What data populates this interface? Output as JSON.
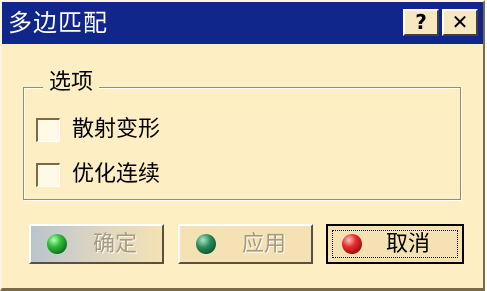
{
  "window": {
    "title": "多边匹配",
    "help_label": "?",
    "close_label": "✕"
  },
  "options_group": {
    "label": "选项",
    "items": [
      {
        "label": "散射变形",
        "checked": false
      },
      {
        "label": "优化连续",
        "checked": false
      }
    ]
  },
  "buttons": {
    "ok": {
      "label": "确定",
      "icon": "green-ball-icon",
      "enabled": false
    },
    "apply": {
      "label": "应用",
      "icon": "green-ball-icon",
      "enabled": false
    },
    "cancel": {
      "label": "取消",
      "icon": "red-ball-icon",
      "enabled": true,
      "focused": true
    }
  },
  "colors": {
    "titlebar": "#10268a",
    "dialog_bg": "#fdeec4"
  }
}
